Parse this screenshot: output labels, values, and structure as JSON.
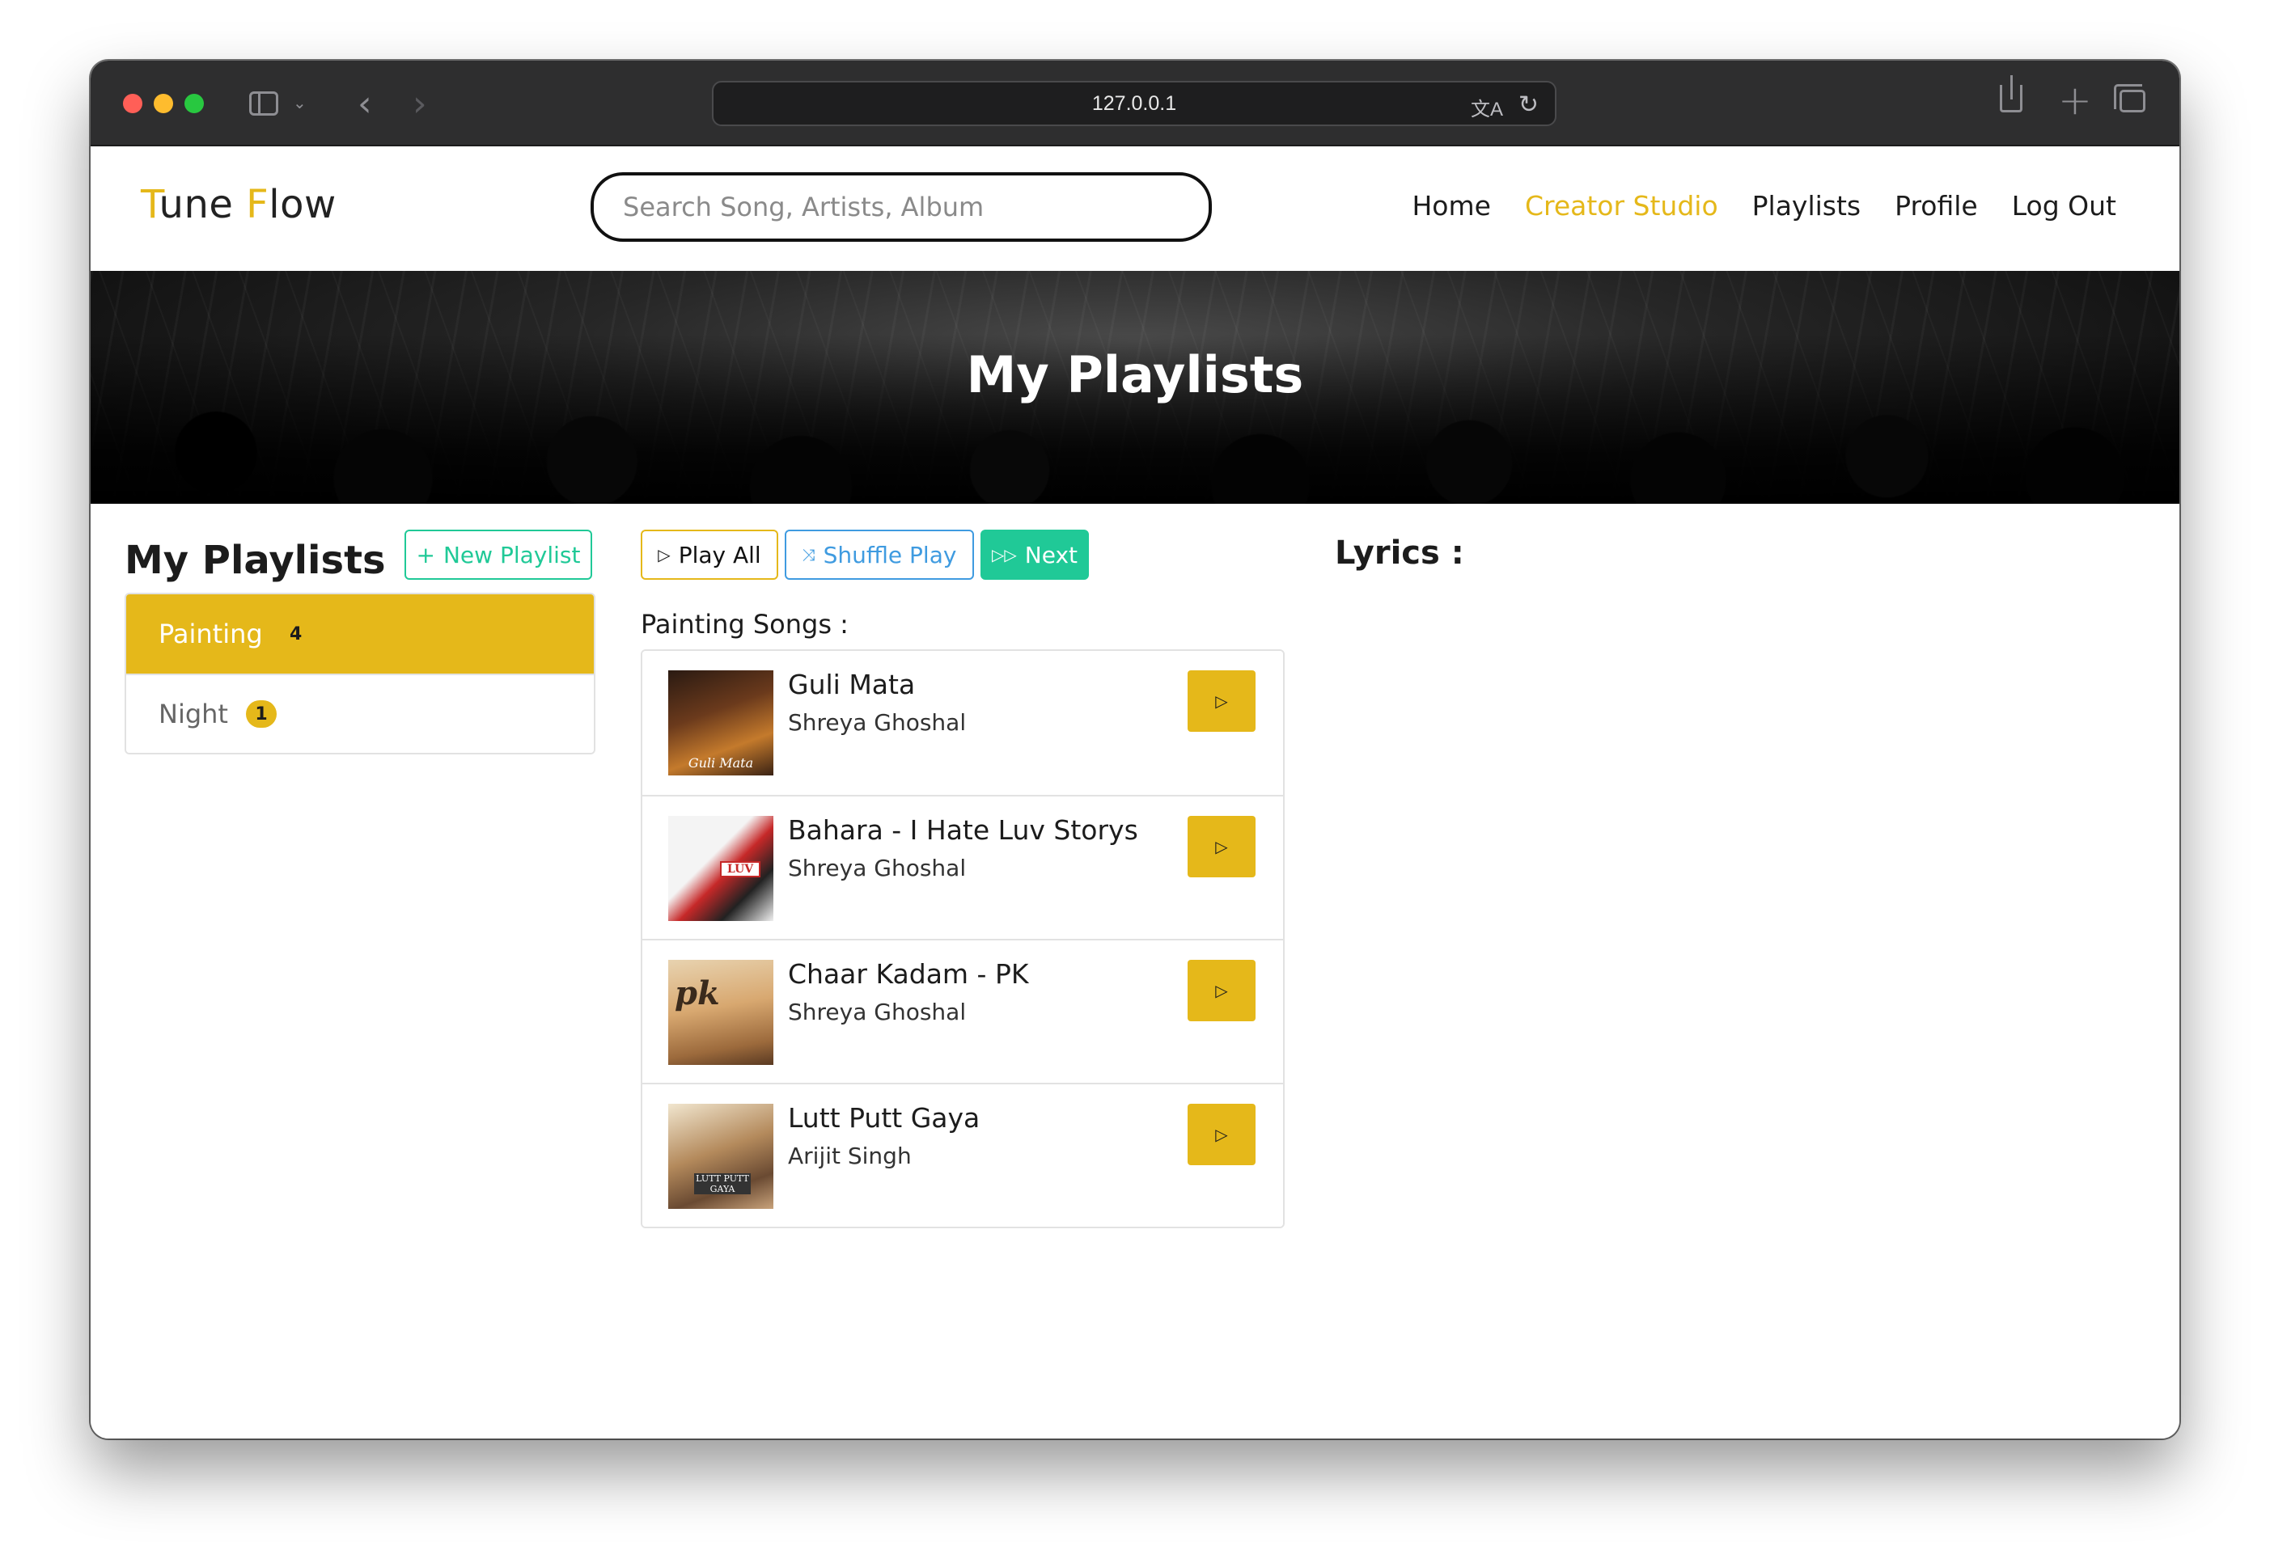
{
  "browser": {
    "url": "127.0.0.1"
  },
  "brand": {
    "first_letter": "T",
    "first_rest": "une ",
    "second_letter": "F",
    "second_rest": "low"
  },
  "search": {
    "placeholder": "Search Song, Artists, Album"
  },
  "nav": {
    "items": [
      {
        "label": "Home"
      },
      {
        "label": "Creator Studio",
        "active": true
      },
      {
        "label": "Playlists"
      },
      {
        "label": "Profile"
      },
      {
        "label": "Log Out"
      }
    ]
  },
  "hero": {
    "title": "My Playlists"
  },
  "playlists": {
    "heading": "My Playlists",
    "new_button": "New Playlist",
    "items": [
      {
        "name": "Painting",
        "count": "4",
        "active": true
      },
      {
        "name": "Night",
        "count": "1",
        "active": false
      }
    ]
  },
  "controls": {
    "play_all": "Play All",
    "shuffle": "Shuffle Play",
    "next": "Next"
  },
  "songs": {
    "label": "Painting Songs :",
    "items": [
      {
        "title": "Guli Mata",
        "artist": "Shreya Ghoshal",
        "cover_text": "Guli Mata"
      },
      {
        "title": "Bahara - I Hate Luv Storys",
        "artist": "Shreya Ghoshal",
        "cover_text": "LUV"
      },
      {
        "title": "Chaar Kadam - PK",
        "artist": "Shreya Ghoshal",
        "cover_text": "pk"
      },
      {
        "title": "Lutt Putt Gaya",
        "artist": "Arijit Singh",
        "cover_text": "LUTT PUTT GAYA"
      }
    ]
  },
  "lyrics": {
    "label": "Lyrics :"
  },
  "colors": {
    "accent": "#e5b81a",
    "teal": "#20c997",
    "blue": "#3f9be0"
  }
}
